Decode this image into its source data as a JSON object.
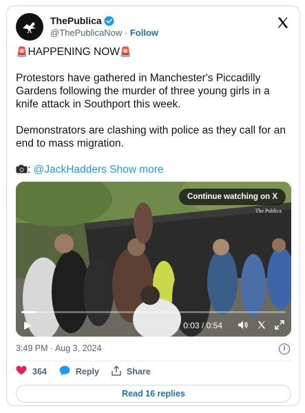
{
  "account": {
    "display_name": "ThePublica",
    "handle": "@ThePublicaNow",
    "separator": "·",
    "follow_label": "Follow",
    "verified": true,
    "brand_logo_icon": "x-logo-icon",
    "avatar_icon": "publica-bird-icon"
  },
  "tweet": {
    "headline": "HAPPENING NOW",
    "paragraph_1": "Protestors have gathered in Manchester's Piccadilly Gardens following the murder of three young girls in a knife attack in Southport this week.",
    "paragraph_2": "Demonstrators are clashing with police as they call for an end to mass migration.",
    "credit_prefix": ":",
    "credit_handle": "@JackHadders",
    "show_more_label": "Show more"
  },
  "video": {
    "continue_label": "Continue watching on X",
    "watermark": "The Publica",
    "current_time": "0:03",
    "time_separator": "/",
    "duration": "0:54",
    "progress_fraction": 0.056
  },
  "meta": {
    "timestamp": "3:49 PM · Aug 3, 2024"
  },
  "actions": {
    "likes_count": "364",
    "reply_label": "Reply",
    "share_label": "Share"
  },
  "read_replies_label": "Read 16 replies",
  "colors": {
    "accent": "#1d9bf0",
    "like": "#e0245e",
    "text": "#0f1419",
    "muted": "#536471"
  }
}
